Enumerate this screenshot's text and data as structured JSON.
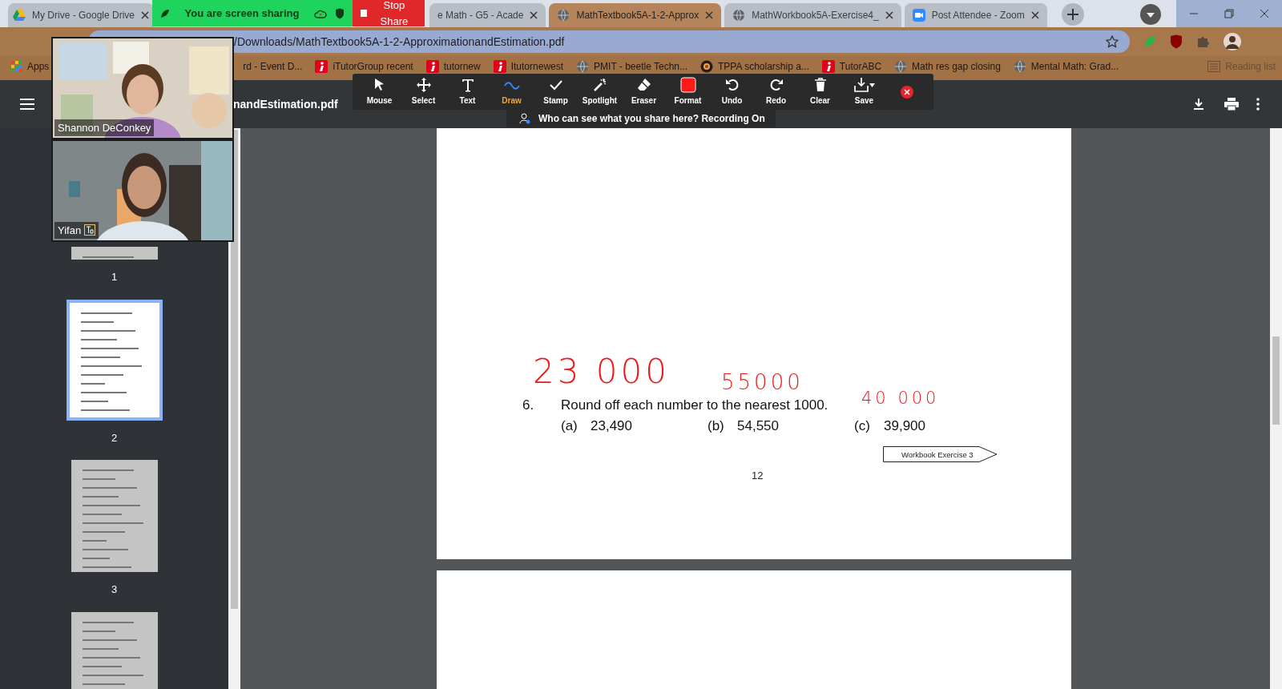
{
  "browser": {
    "tabs": [
      {
        "title": "My Drive - Google Drive",
        "kind": "drive",
        "selected": false
      },
      {
        "title": "e Math - G5 - Acade",
        "kind": "plain",
        "selected": false
      },
      {
        "title": "MathTextbook5A-1-2-Approx",
        "kind": "web",
        "selected": true
      },
      {
        "title": "MathWorkbook5A-Exercise4_",
        "kind": "web",
        "selected": false
      },
      {
        "title": "Post Attendee - Zoom",
        "kind": "meeting",
        "selected": false
      }
    ],
    "address": "/Downloads/MathTextbook5A-1-2-ApproximationandEstimation.pdf",
    "bookmarks": [
      {
        "label": "Apps",
        "kind": "apps"
      },
      {
        "label": "rd - Event D...",
        "kind": "plain"
      },
      {
        "label": "iTutorGroup recent",
        "kind": "tile"
      },
      {
        "label": "tutornew",
        "kind": "tile"
      },
      {
        "label": "Itutornewest",
        "kind": "tile"
      },
      {
        "label": "PMIT - beetle Techn...",
        "kind": "web"
      },
      {
        "label": "TPPA scholarship a...",
        "kind": "seal"
      },
      {
        "label": "TutorABC",
        "kind": "tile"
      },
      {
        "label": "Math res gap closing",
        "kind": "web"
      },
      {
        "label": "Mental Math: Grad...",
        "kind": "web"
      }
    ],
    "reading_list": "Reading list"
  },
  "share_banner": {
    "status": "You are screen sharing",
    "stop": "Stop Share"
  },
  "annotate_toolbar": {
    "tools": [
      {
        "label": "Mouse",
        "selected": false
      },
      {
        "label": "Select",
        "selected": false
      },
      {
        "label": "Text",
        "selected": false
      },
      {
        "label": "Draw",
        "selected": true
      },
      {
        "label": "Stamp",
        "selected": false
      },
      {
        "label": "Spotlight",
        "selected": false
      },
      {
        "label": "Eraser",
        "selected": false
      },
      {
        "label": "Format",
        "selected": false
      },
      {
        "label": "Undo",
        "selected": false
      },
      {
        "label": "Redo",
        "selected": false
      },
      {
        "label": "Clear",
        "selected": false
      },
      {
        "label": "Save",
        "selected": false
      }
    ],
    "notice": "Who can see what you share here? Recording On"
  },
  "video_tiles": [
    {
      "name": "Shannon DeConkey",
      "captions": false
    },
    {
      "name": "Yifan",
      "captions": true
    }
  ],
  "pdf": {
    "title": "nandEstimation.pdf",
    "thumbnails": [
      {
        "label": "1",
        "selected": false
      },
      {
        "label": "2",
        "selected": true
      },
      {
        "label": "3",
        "selected": false
      },
      {
        "selected": false
      }
    ],
    "question": {
      "number": "6.",
      "text": "Round off each number to the nearest 1000.",
      "parts": [
        {
          "label": "(a)",
          "value": "23,490"
        },
        {
          "label": "(b)",
          "value": "54,550"
        },
        {
          "label": "(c)",
          "value": "39,900"
        }
      ]
    },
    "handwritten": [
      "23 000",
      "55000",
      "40 000"
    ],
    "link": "Workbook Exercise 3",
    "page_number": "12"
  }
}
